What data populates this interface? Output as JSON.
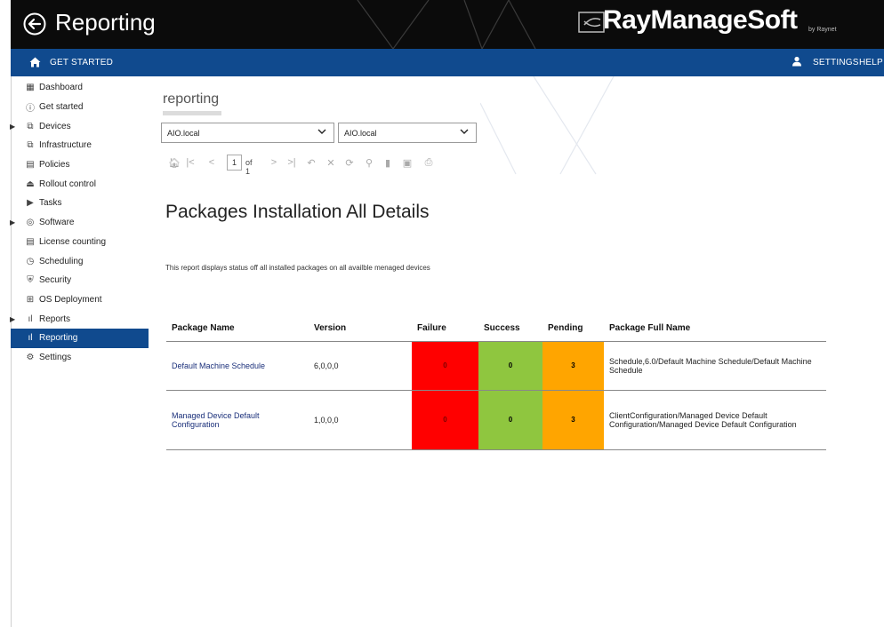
{
  "header": {
    "title": "Reporting",
    "brand": "RayManageSoft",
    "brand_sub": "by Raynet"
  },
  "navbar": {
    "get_started": "GET STARTED",
    "settings": "SETTINGS",
    "help": "HELP"
  },
  "sidebar": {
    "items": [
      {
        "label": "Dashboard",
        "icon": "dashboard-icon"
      },
      {
        "label": "Get started",
        "icon": "info-icon"
      },
      {
        "label": "Devices",
        "icon": "devices-icon"
      },
      {
        "label": "Infrastructure",
        "icon": "infrastructure-icon"
      },
      {
        "label": "Policies",
        "icon": "policies-icon"
      },
      {
        "label": "Rollout control",
        "icon": "rollout-icon"
      },
      {
        "label": "Tasks",
        "icon": "tasks-icon"
      },
      {
        "label": "Software",
        "icon": "software-icon"
      },
      {
        "label": "License counting",
        "icon": "license-icon"
      },
      {
        "label": "Scheduling",
        "icon": "clock-icon"
      },
      {
        "label": "Security",
        "icon": "shield-icon"
      },
      {
        "label": "OS Deployment",
        "icon": "windows-icon"
      },
      {
        "label": "Reports",
        "icon": "bar-chart-icon"
      },
      {
        "label": "Reporting",
        "icon": "bar-chart-icon"
      },
      {
        "label": "Settings",
        "icon": "gear-icon"
      }
    ],
    "active": "Reporting"
  },
  "report": {
    "heading": "reporting",
    "select1": "AIO.local",
    "select2": "AIO.local",
    "page_current": "1",
    "page_of": "of 1",
    "title": "Packages Installation All Details",
    "description": "This report displays status off all installed packages on all availble menaged devices"
  },
  "table": {
    "columns": [
      "Package Name",
      "Version",
      "Failure",
      "Success",
      "Pending",
      "Package Full Name"
    ],
    "rows": [
      {
        "name": "Default Machine Schedule",
        "version": "6,0,0,0",
        "failure": "0",
        "success": "0",
        "pending": "3",
        "full_name": "Schedule,6.0/Default Machine Schedule/Default Machine Schedule"
      },
      {
        "name": "Managed Device Default Configuration",
        "version": "1,0,0,0",
        "failure": "0",
        "success": "0",
        "pending": "3",
        "full_name": "ClientConfiguration/Managed Device Default Configuration/Managed Device Default Configuration"
      }
    ]
  },
  "colors": {
    "navbar": "#104a8e",
    "titlebar": "#0b0b0b",
    "failure": "#ff0000",
    "success": "#8fc63f",
    "pending": "#ffa500"
  }
}
